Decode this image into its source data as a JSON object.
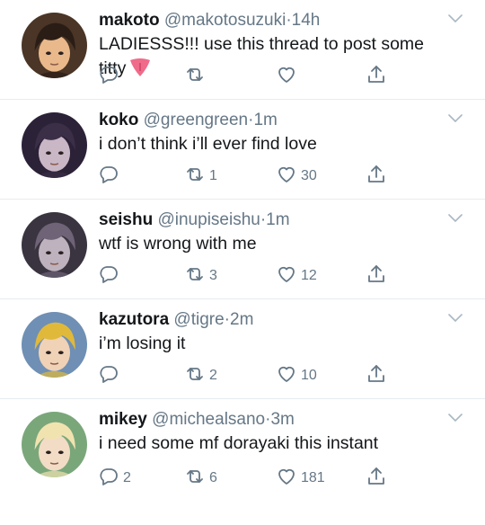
{
  "tweets": [
    {
      "name": "makoto",
      "handle": "@makotosuzuki",
      "separator": "·",
      "time": "14h",
      "text_lines": [
        "LADIESSS!!! use this thread to post some",
        "titty"
      ],
      "reply_count": "",
      "retweet_count": "",
      "like_count": "",
      "avatar_colors": {
        "bg": "#4a3526",
        "skin": "#e9b98b",
        "hair": "#2a1d16"
      }
    },
    {
      "name": "koko",
      "handle": "@greengreen",
      "separator": "·",
      "time": "1m",
      "text_lines": [
        "i don’t think i’ll ever find love"
      ],
      "reply_count": "",
      "retweet_count": "1",
      "like_count": "30",
      "avatar_colors": {
        "bg": "#2b2238",
        "skin": "#c9b7c6",
        "hair": "#3b2e47"
      }
    },
    {
      "name": "seishu",
      "handle": "@inupiseishu",
      "separator": "·",
      "time": "1m",
      "text_lines": [
        "wtf is wrong with me"
      ],
      "reply_count": "",
      "retweet_count": "3",
      "like_count": "12",
      "avatar_colors": {
        "bg": "#3a3440",
        "skin": "#bdb2bd",
        "hair": "#6e6377"
      }
    },
    {
      "name": "kazutora",
      "handle": "@tigre",
      "separator": "·",
      "time": "2m",
      "text_lines": [
        "i’m losing it"
      ],
      "reply_count": "",
      "retweet_count": "2",
      "like_count": "10",
      "avatar_colors": {
        "bg": "#6f8fb4",
        "skin": "#f0d2b6",
        "hair": "#e0b93a"
      }
    },
    {
      "name": "mikey",
      "handle": "@michealsano",
      "separator": "·",
      "time": "3m",
      "text_lines": [
        "i need some mf dorayaki this instant"
      ],
      "reply_count": "2",
      "retweet_count": "6",
      "like_count": "181",
      "avatar_colors": {
        "bg": "#7aa77a",
        "skin": "#f2dcc6",
        "hair": "#f1e3b0"
      }
    }
  ],
  "colors": {
    "text": "#14171a",
    "muted": "#657786",
    "divider": "#e6ecf0",
    "icon": "#657786"
  },
  "icons": {
    "reply": "reply-icon",
    "retweet": "retweet-icon",
    "like": "heart-icon",
    "share": "share-icon",
    "menu": "chevron-down-icon",
    "emoji": "tongue-emoji"
  }
}
